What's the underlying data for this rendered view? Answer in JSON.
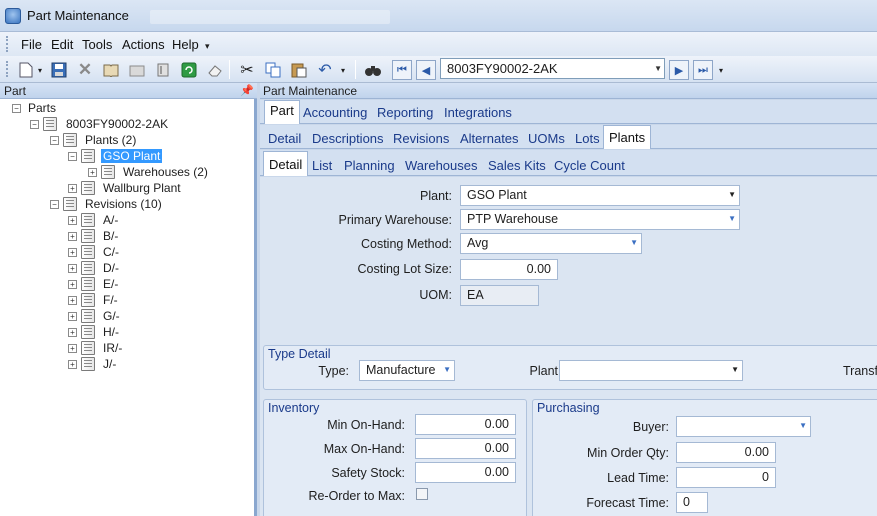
{
  "window": {
    "title": "Part Maintenance"
  },
  "menu": [
    "File",
    "Edit",
    "Tools",
    "Actions",
    "Help"
  ],
  "toolbar": {
    "part_combo_value": "8003FY90002-2AK"
  },
  "left_panel": {
    "title": "Part",
    "tree": {
      "root": "Parts",
      "part": "8003FY90002-2AK",
      "plants": "Plants (2)",
      "gso_plant": "GSO Plant",
      "warehouses": "Warehouses (2)",
      "wallburg": "Wallburg Plant",
      "revisions": "Revisions (10)",
      "rev_items": [
        "A/-",
        "B/-",
        "C/-",
        "D/-",
        "E/-",
        "F/-",
        "G/-",
        "H/-",
        "IR/-",
        "J/-"
      ]
    }
  },
  "right_panel": {
    "title": "Part Maintenance",
    "tabs_level1": [
      "Part",
      "Accounting",
      "Reporting",
      "Integrations"
    ],
    "tabs_level2": [
      "Detail",
      "Descriptions",
      "Revisions",
      "Alternates",
      "UOMs",
      "Lots",
      "Plants"
    ],
    "tabs_level3": [
      "Detail",
      "List",
      "Planning",
      "Warehouses",
      "Sales Kits",
      "Cycle Count"
    ],
    "form": {
      "plant_label": "Plant:",
      "plant_value": "GSO Plant",
      "primary_wh_label": "Primary Warehouse:",
      "primary_wh_value": "PTP Warehouse",
      "costing_method_label": "Costing Method:",
      "costing_method_value": "Avg",
      "costing_lot_label": "Costing Lot Size:",
      "costing_lot_value": "0.00",
      "uom_label": "UOM:",
      "uom_value": "EA"
    },
    "type_detail": {
      "title": "Type Detail",
      "type_label": "Type:",
      "type_value": "Manufacture",
      "plant_label": "Plant",
      "plant_value": "",
      "transfer_label": "Transf"
    },
    "inventory": {
      "title": "Inventory",
      "min_label": "Min On-Hand:",
      "min_value": "0.00",
      "max_label": "Max On-Hand:",
      "max_value": "0.00",
      "safety_label": "Safety Stock:",
      "safety_value": "0.00",
      "reorder_label": "Re-Order to Max:",
      "reorder_checked": false
    },
    "purchasing": {
      "title": "Purchasing",
      "buyer_label": "Buyer:",
      "buyer_value": "",
      "min_order_label": "Min Order Qty:",
      "min_order_value": "0.00",
      "lead_label": "Lead Time:",
      "lead_value": "0",
      "forecast_label": "Forecast Time:",
      "forecast_value": "0"
    }
  },
  "colors": {
    "accent": "#3399ff",
    "tab_text": "#1a3a8a",
    "panel_bg": "#dbe5f2"
  }
}
